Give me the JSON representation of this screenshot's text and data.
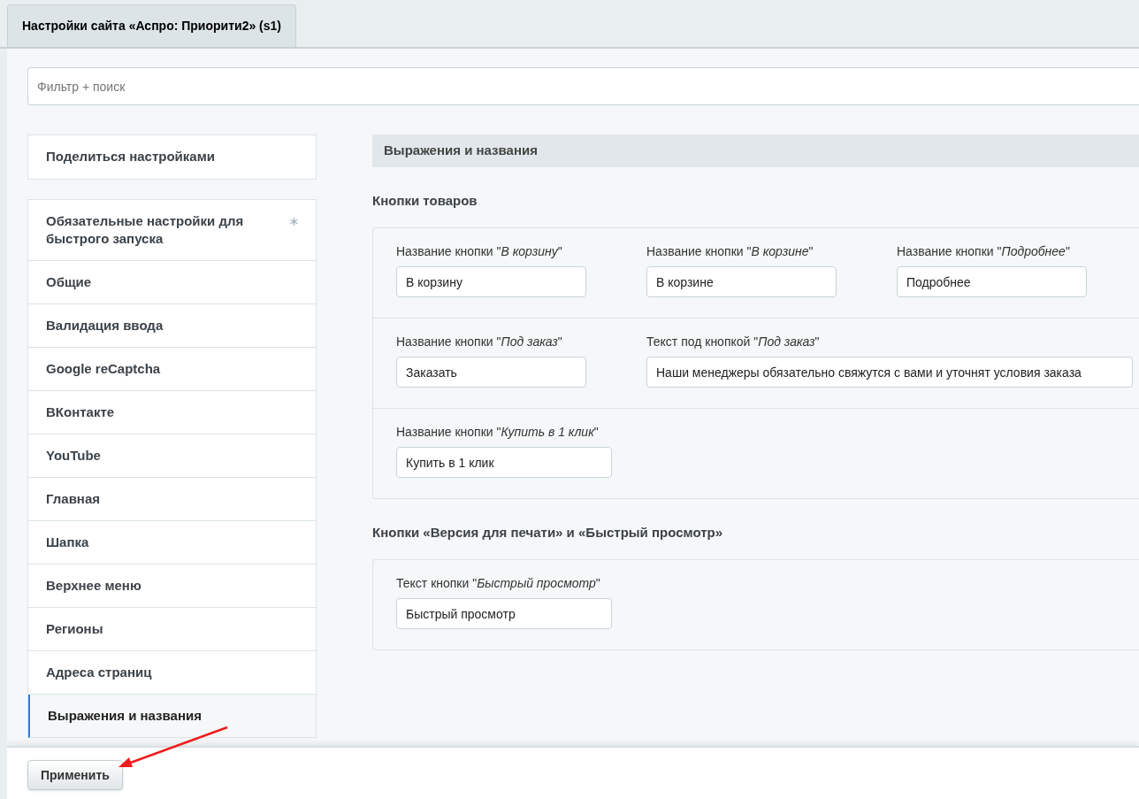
{
  "tabs": [
    {
      "label": "Настройки сайта «Аспро: Приорити2» (s1)",
      "selected": true
    }
  ],
  "filter": {
    "placeholder": "Фильтр + поиск"
  },
  "share_button": "Поделиться настройками",
  "sidebar": {
    "items": [
      {
        "label": "Обязательные настройки для быстрого запуска",
        "required": true,
        "selected": false
      },
      {
        "label": "Общие",
        "required": false,
        "selected": false
      },
      {
        "label": "Валидация ввода",
        "required": false,
        "selected": false
      },
      {
        "label": "Google reCaptcha",
        "required": false,
        "selected": false
      },
      {
        "label": "ВКонтакте",
        "required": false,
        "selected": false
      },
      {
        "label": "YouTube",
        "required": false,
        "selected": false
      },
      {
        "label": "Главная",
        "required": false,
        "selected": false
      },
      {
        "label": "Шапка",
        "required": false,
        "selected": false
      },
      {
        "label": "Верхнее меню",
        "required": false,
        "selected": false
      },
      {
        "label": "Регионы",
        "required": false,
        "selected": false
      },
      {
        "label": "Адреса страниц",
        "required": false,
        "selected": false
      },
      {
        "label": "Выражения и названия",
        "required": false,
        "selected": true
      }
    ]
  },
  "section": {
    "title": "Выражения и названия",
    "groups": [
      {
        "title": "Кнопки товаров",
        "rows": [
          [
            {
              "label": "Название кнопки \"*В корзину*\"",
              "value": "В корзину"
            },
            {
              "label": "Название кнопки \"*В корзине*\"",
              "value": "В корзине"
            },
            {
              "label": "Название кнопки \"*Подробнее*\"",
              "value": "Подробнее"
            }
          ],
          [
            {
              "label": "Название кнопки \"*Под заказ*\"",
              "value": "Заказать"
            },
            {
              "label": "Текст под кнопкой \"*Под заказ*\"",
              "value": "Наши менеджеры обязательно свяжутся с вами и уточнят условия заказа"
            }
          ],
          [
            {
              "label": "Название кнопки \"*Купить в 1 клик*\"",
              "value": "Купить в 1 клик"
            }
          ]
        ]
      },
      {
        "title": "Кнопки «Версия для печати» и «Быстрый просмотр»",
        "rows": [
          [
            {
              "label": "Текст кнопки \"*Быстрый просмотр*\"",
              "value": "Быстрый просмотр"
            }
          ]
        ]
      }
    ]
  },
  "apply_button": "Применить"
}
